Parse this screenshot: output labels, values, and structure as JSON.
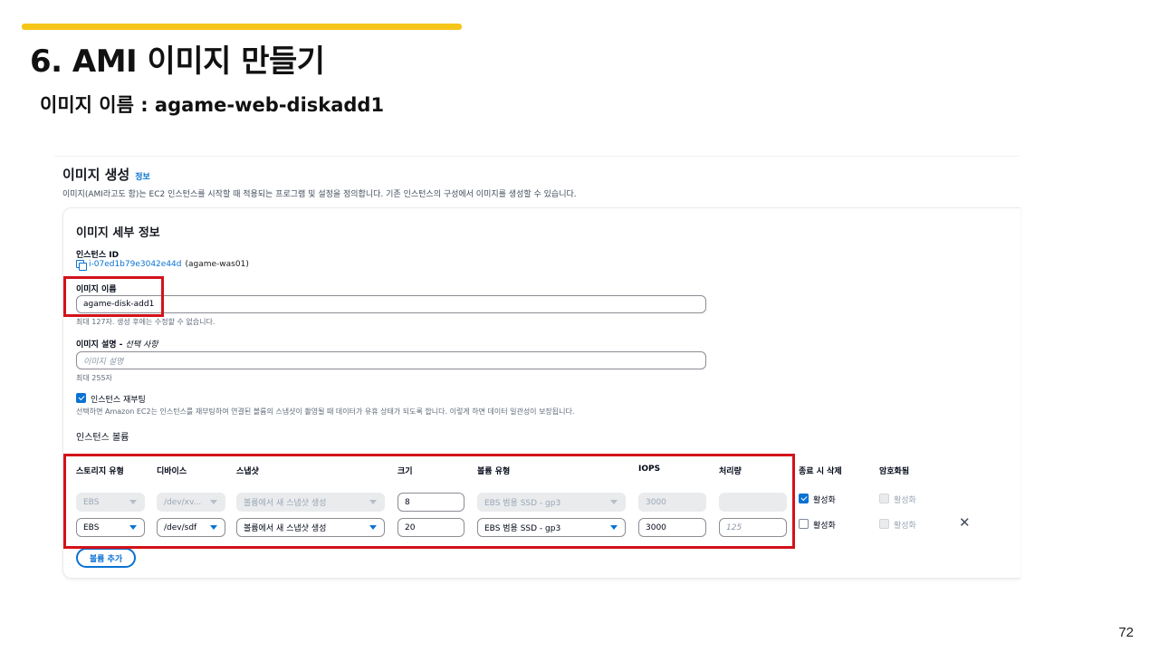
{
  "slide": {
    "title": "6. AMI 이미지 만들기",
    "subtitle": "이미지 이름 : agame-web-diskadd1",
    "page_number": "72"
  },
  "console": {
    "heading": "이미지 생성",
    "info_link": "정보",
    "description": "이미지(AMI라고도 함)는 EC2 인스턴스를 시작할 때 적용되는 프로그램 및 설정을 정의합니다. 기존 인스턴스의 구성에서 이미지를 생성할 수 있습니다.",
    "card_title": "이미지 세부 정보",
    "instance_id_label": "인스턴스 ID",
    "instance_id": "i-07ed1b79e3042e44d",
    "instance_name": "(agame-was01)",
    "image_name_label": "이미지 이름",
    "image_name_value": "agame-disk-add1",
    "image_name_hint": "최대 127자. 생성 후에는 수정할 수 없습니다.",
    "image_desc_label": "이미지 설명 - ",
    "image_desc_optional": "선택 사항",
    "image_desc_placeholder": "이미지 설명",
    "image_desc_hint": "최대 255자",
    "reboot_label": "인스턴스 재부팅",
    "reboot_hint": "선택하면 Amazon EC2는 인스턴스를 재부팅하여 연결된 볼륨의 스냅샷이 촬영될 때 데이터가 유휴 상태가 되도록 합니다. 이렇게 하면 데이터 일관성이 보장됩니다.",
    "volumes_title": "인스턴스 볼륨",
    "columns": [
      "스토리지 유형",
      "디바이스",
      "스냅샷",
      "크기",
      "볼륨 유형",
      "IOPS",
      "처리량",
      "종료 시 삭제",
      "암호화됨"
    ],
    "rows": [
      {
        "storage": "EBS",
        "device": "/dev/xv...",
        "snapshot": "볼륨에서 새 스냅샷 생성",
        "size": "8",
        "volume_type": "EBS 범용 SSD - gp3",
        "iops": "3000",
        "throughput": "",
        "delete_on_termination": "활성화",
        "encrypted": "활성화"
      },
      {
        "storage": "EBS",
        "device": "/dev/sdf",
        "snapshot": "볼륨에서 새 스냅샷 생성",
        "size": "20",
        "volume_type": "EBS 범용 SSD - gp3",
        "iops": "3000",
        "throughput_placeholder": "125",
        "delete_on_termination": "활성화",
        "encrypted": "활성화"
      }
    ],
    "add_volume_label": "볼륨 추가"
  }
}
